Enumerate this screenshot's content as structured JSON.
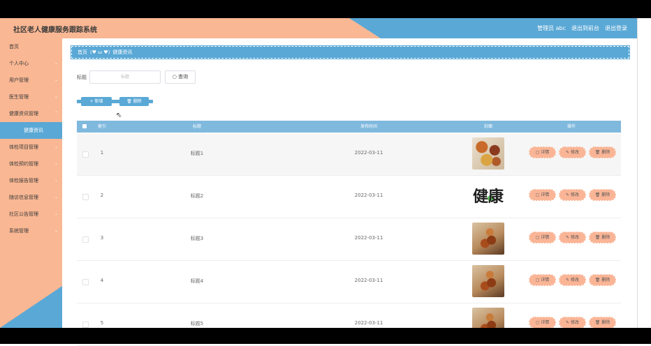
{
  "header": {
    "title": "社区老人健康服务跟踪系统",
    "user_label": "管理员 abc",
    "back_to_front": "退出到前台",
    "logout": "退出登录"
  },
  "sidebar": {
    "items": [
      {
        "label": "首页"
      },
      {
        "label": "个人中心"
      },
      {
        "label": "用户管理"
      },
      {
        "label": "医生管理"
      },
      {
        "label": "健康资讯管理"
      },
      {
        "label": "健康资讯"
      },
      {
        "label": "体检项目管理"
      },
      {
        "label": "体检预约管理"
      },
      {
        "label": "体检报告管理"
      },
      {
        "label": "随访信息管理"
      },
      {
        "label": "社区公告管理"
      },
      {
        "label": "系统管理"
      }
    ]
  },
  "breadcrumb": {
    "home": "首页",
    "emoji": "(♥ ω ♥)",
    "current": "健康资讯"
  },
  "search": {
    "label": "标题",
    "placeholder": "标题",
    "button": "查询"
  },
  "actions": {
    "add": "+ 新增",
    "delete": "删除"
  },
  "table": {
    "columns": {
      "index": "索引",
      "title": "标题",
      "publish_time": "发布时间",
      "cover": "封面",
      "operations": "操作"
    },
    "rows": [
      {
        "index": "1",
        "title": "标题1",
        "time": "2022-03-11"
      },
      {
        "index": "2",
        "title": "标题2",
        "time": "2022-03-11"
      },
      {
        "index": "3",
        "title": "标题3",
        "time": "2022-03-11"
      },
      {
        "index": "4",
        "title": "标题4",
        "time": "2022-03-11"
      },
      {
        "index": "5",
        "title": "标题5",
        "time": "2022-03-11"
      }
    ],
    "op_labels": {
      "detail": "详情",
      "edit": "修改",
      "delete": "删除"
    },
    "cover_text": "健康"
  },
  "colors": {
    "accent_blue": "#5aa8d6",
    "accent_peach": "#f9b793"
  }
}
